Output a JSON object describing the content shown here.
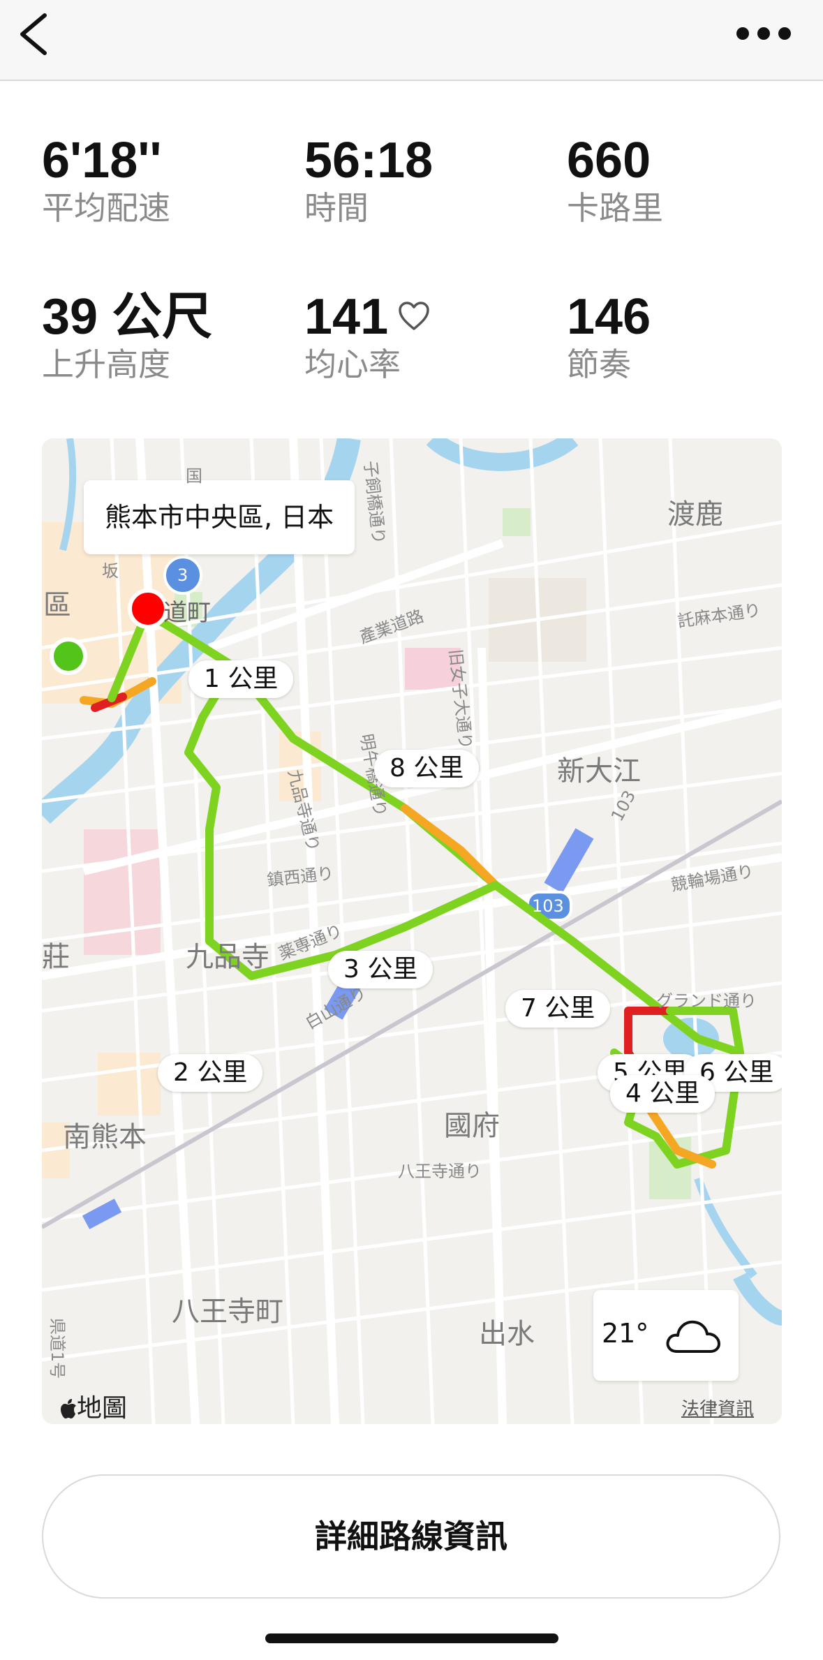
{
  "nav": {
    "back_icon": "chevron-left-icon",
    "more_icon": "ellipsis-icon"
  },
  "stats": {
    "pace": {
      "value": "6'18''",
      "label": "平均配速"
    },
    "time": {
      "value": "56:18",
      "label": "時間"
    },
    "calories": {
      "value": "660",
      "label": "卡路里"
    },
    "elevation": {
      "value": "39 公尺",
      "label": "上升高度"
    },
    "heart_rate": {
      "value": "141",
      "label": "均心率",
      "icon": "heart-icon"
    },
    "cadence": {
      "value": "146",
      "label": "節奏"
    }
  },
  "map": {
    "location": "熊本市中央區, 日本",
    "labels": {
      "watari": "渡鹿",
      "shin_oe": "新大江",
      "kuhonji": "九品寺",
      "kokufu": "國府",
      "minami_kumamoto": "南熊本",
      "hachioji": "八王寺町",
      "demizu": "出水",
      "ku": "區",
      "so": "莊",
      "michimachi": "道町",
      "sangyo": "產業道路",
      "kyu_joshidai": "旧女子大通り",
      "meigo": "明午橋通り",
      "kuhonji_st": "九品寺通り",
      "chinzei": "鎮西通り",
      "yakusen": "薬専通り",
      "shirayama": "白山通り",
      "hachioji_st": "八王寺通り",
      "keirin": "競輪場通り",
      "takuma": "託麻本通り",
      "grand": "グランド通り",
      "shishibashi": "子飼橋通り",
      "kendo": "県道1号",
      "route3": "3",
      "route103": "103",
      "highway_sign": "国",
      "hashi": "坂"
    },
    "km_markers": [
      "1 公里",
      "2 公里",
      "3 公里",
      "4 公里",
      "5 公里",
      "6 公里",
      "7 公里",
      "8 公里"
    ],
    "weather": {
      "temp": "21°",
      "icon": "cloud-icon"
    },
    "attribution": "地圖",
    "legal": "法律資訊",
    "route_colors": {
      "fast": "#7ed321",
      "mid": "#f5a623",
      "slow": "#e02020",
      "start": "#52c41a",
      "end": "#ff0000"
    }
  },
  "detail_button": {
    "label": "詳細路線資訊"
  }
}
